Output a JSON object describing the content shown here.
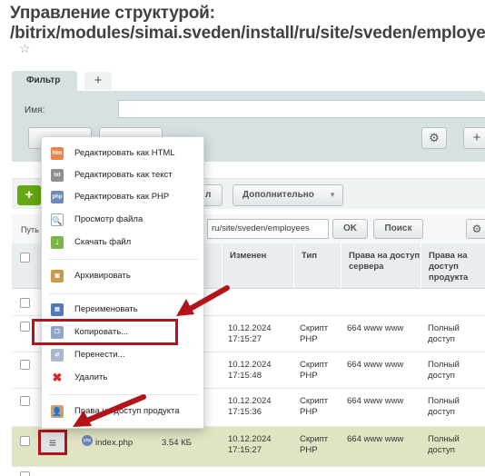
{
  "page": {
    "title_line1": "Управление структурой:",
    "title_line2": "/bitrix/modules/simai.sveden/install/ru/site/sveden/employees"
  },
  "filter": {
    "tab_label": "Фильтр",
    "add_tab_label": "+",
    "name_label": "Имя:",
    "add_label": "+"
  },
  "toolbar": {
    "add_label": "+",
    "hidden_button_suffix": "л",
    "more_label": "Дополнительно"
  },
  "path_bar": {
    "label": "Путь",
    "value": "ru/site/sveden/employees",
    "ok_label": "OK",
    "search_label": "Поиск"
  },
  "grid": {
    "columns": [
      "Изменен",
      "Тип",
      "Права на доступ сервера",
      "Права на доступ продукта"
    ],
    "rows": [
      {
        "changed": "10.12.2024 17:15:27",
        "type": "Скрипт PHP",
        "server": "664 www www",
        "product": "Полный доступ"
      },
      {
        "changed": "10.12.2024 17:15:48",
        "type": "Скрипт PHP",
        "server": "664 www www",
        "product": "Полный доступ"
      },
      {
        "changed": "10.12.2024 17:15:36",
        "type": "Скрипт PHP",
        "server": "664 www www",
        "product": "Полный доступ"
      },
      {
        "name": "index.php",
        "size": "3.54 КБ",
        "changed": "10.12.2024 17:15:27",
        "type": "Скрипт PHP",
        "server": "664 www www",
        "product": "Полный доступ"
      }
    ]
  },
  "context_menu": {
    "items": [
      {
        "label": "Редактировать как HTML",
        "icon": "html-icon"
      },
      {
        "label": "Редактировать как текст",
        "icon": "txt-icon"
      },
      {
        "label": "Редактировать как PHP",
        "icon": "php-icon"
      },
      {
        "label": "Просмотр файла",
        "icon": "view-icon"
      },
      {
        "label": "Скачать файл",
        "icon": "download-icon"
      },
      {
        "label": "Архивировать",
        "icon": "archive-icon"
      },
      {
        "label": "Переименовать",
        "icon": "rename-icon"
      },
      {
        "label": "Копировать...",
        "icon": "copy-icon"
      },
      {
        "label": "Перенести...",
        "icon": "move-icon"
      },
      {
        "label": "Удалить",
        "icon": "delete-icon"
      },
      {
        "label": "Права на доступ продукта",
        "icon": "access-icon"
      }
    ]
  },
  "colors": {
    "highlight": "#b3141a",
    "selected_row": "#dfe5c2",
    "add_button": "#66a80f"
  }
}
